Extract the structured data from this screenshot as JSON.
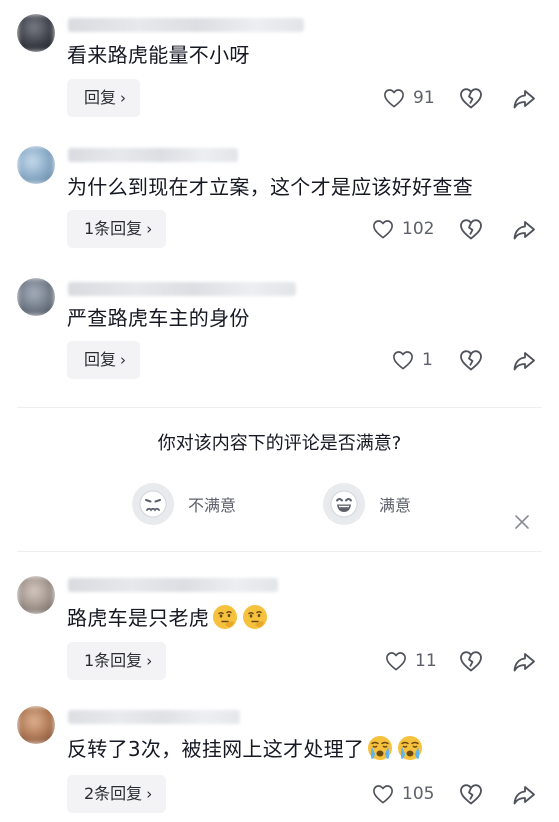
{
  "comments": [
    {
      "text": "看来路虎能量不小呀",
      "reply_label": "回复",
      "like_count": "91",
      "avatar_colors": [
        "#5b5e66",
        "#20232b"
      ],
      "username_visible": "五球出"
    },
    {
      "text": "为什么到现在才立案，这个才是应该好好查查",
      "reply_label": "1条回复",
      "like_count": "102",
      "avatar_colors": [
        "#a7c3dc",
        "#6e8aa6"
      ],
      "username_visible": "脉"
    },
    {
      "text": "严查路虎车主的身份",
      "reply_label": "回复",
      "like_count": "1",
      "avatar_colors": [
        "#8f99a8",
        "#4a5360"
      ]
    },
    {
      "text": "路虎车是只老虎",
      "reply_label": "1条回复",
      "like_count": "11",
      "avatar_colors": [
        "#b7a9a0",
        "#6e6661"
      ],
      "emojis": [
        "thinking-face",
        "thinking-face"
      ]
    },
    {
      "text": "反转了3次，被挂网上这才处理了",
      "reply_label": "2条回复",
      "like_count": "105",
      "avatar_colors": [
        "#c48d6a",
        "#7e4f37"
      ],
      "username_visible": "五彩音 · 43分钟前",
      "emojis": [
        "crying-face",
        "crying-face"
      ]
    }
  ],
  "survey": {
    "question": "你对该内容下的评论是否满意?",
    "negative_label": "不满意",
    "positive_label": "满意"
  },
  "colors": {
    "text": "#161823",
    "muted": "#5d606a",
    "button_bg": "#f3f3f5"
  }
}
